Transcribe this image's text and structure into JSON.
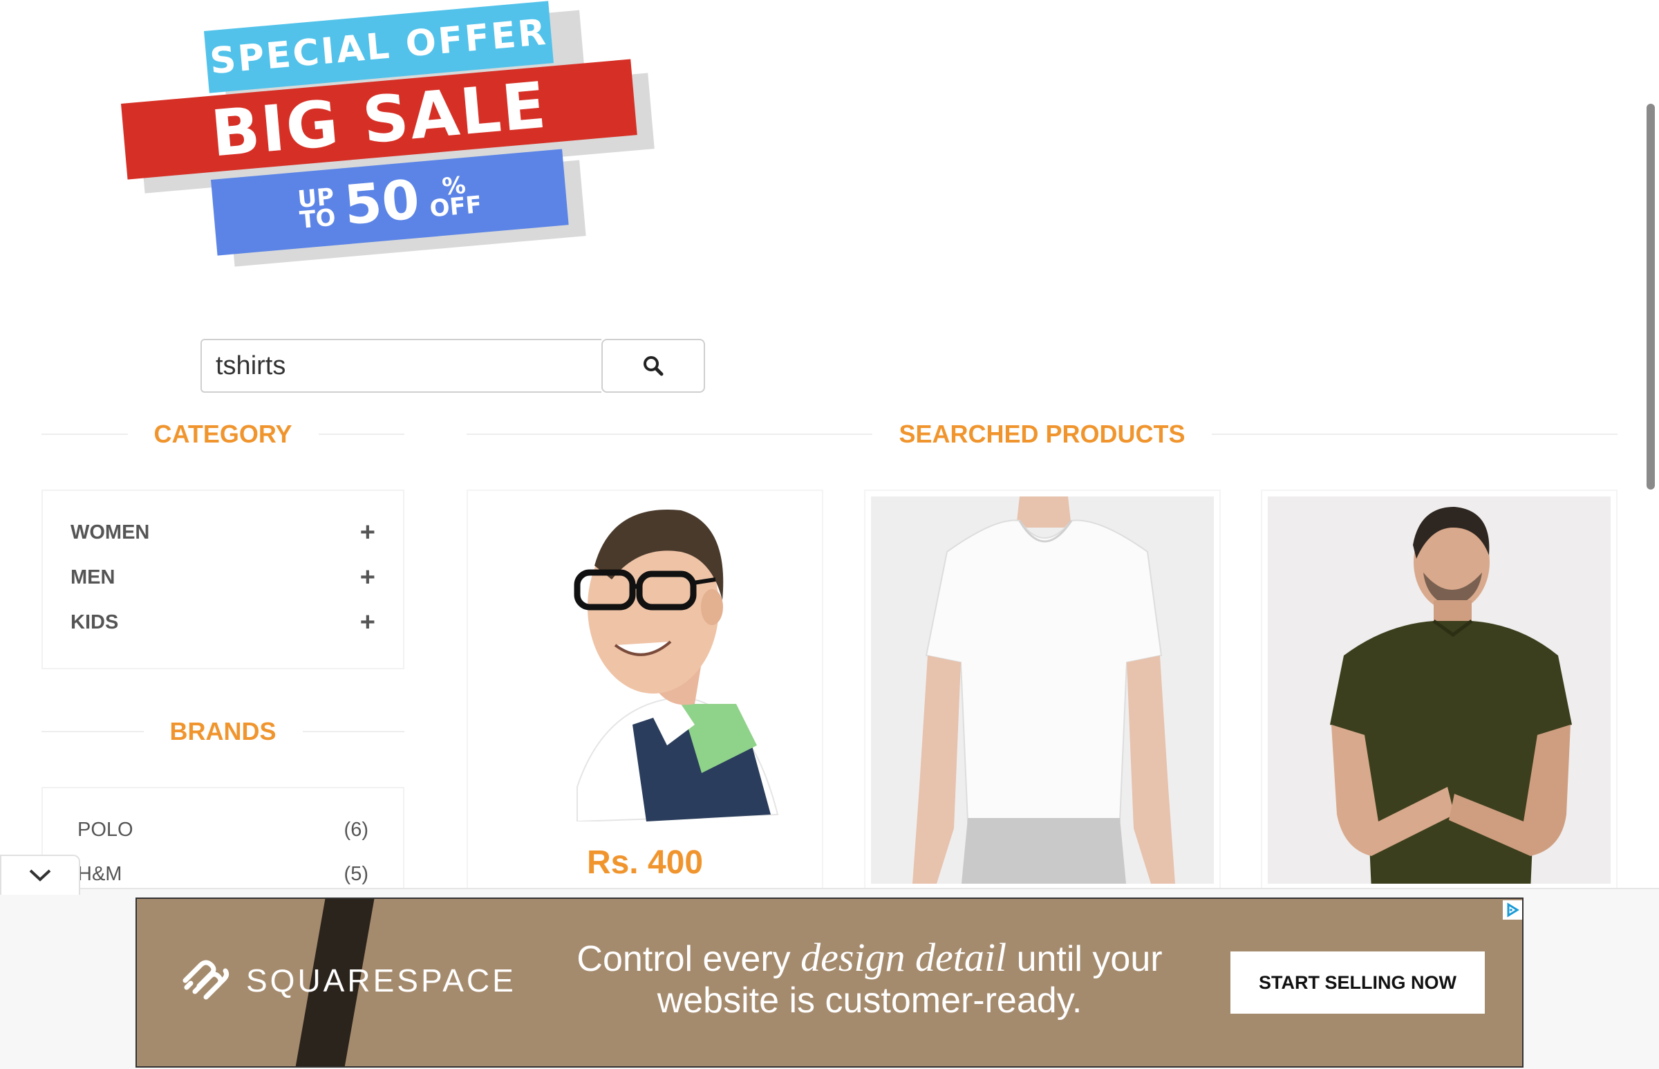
{
  "promo": {
    "special_offer": "SPECIAL OFFER",
    "big_sale": "BIG SALE",
    "up": "UP",
    "to": "TO",
    "amount": "50",
    "percent": "%",
    "off": "OFF"
  },
  "search": {
    "value": "tshirts",
    "button_icon": "search-icon"
  },
  "sidebar": {
    "category_title": "CATEGORY",
    "categories": [
      {
        "label": "WOMEN",
        "toggle": "+"
      },
      {
        "label": "MEN",
        "toggle": "+"
      },
      {
        "label": "KIDS",
        "toggle": "+"
      }
    ],
    "brands_title": "BRANDS",
    "brands": [
      {
        "label": "POLO",
        "count": "(6)"
      },
      {
        "label": "H&M",
        "count": "(5)"
      }
    ]
  },
  "main": {
    "title": "SEARCHED PRODUCTS",
    "products": [
      {
        "price": "Rs. 400"
      },
      {
        "price": ""
      },
      {
        "price": ""
      }
    ]
  },
  "ad": {
    "brand": "SQUARESPACE",
    "headline_pre": "Control every ",
    "headline_em": "design detail",
    "headline_post": " until your",
    "headline_line2": "website is customer-ready.",
    "cta": "START SELLING NOW",
    "colors": {
      "background": "#a58b6e",
      "cta_bg": "#ffffff"
    }
  },
  "colors": {
    "accent": "#f0952e",
    "sale_red": "#d63026",
    "offer_blue": "#52c2ea",
    "upto_blue": "#5b84e6"
  }
}
